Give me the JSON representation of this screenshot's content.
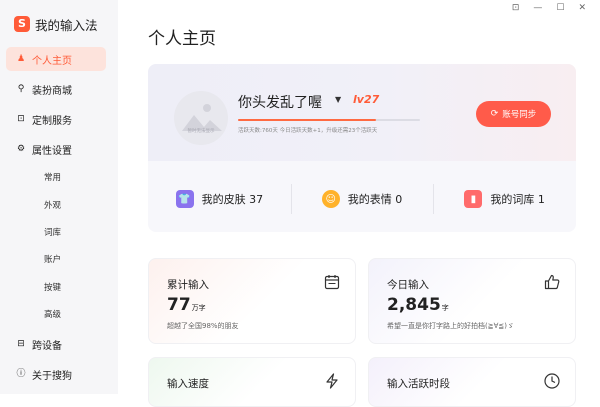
{
  "app": {
    "title": "我的输入法",
    "logo_letter": "S"
  },
  "window_controls": {
    "feedback": "⊡",
    "minimize": "—",
    "maximize": "☐",
    "close": "✕"
  },
  "sidebar": {
    "items": [
      {
        "label": "个人主页",
        "icon": "user-icon",
        "glyph": "♟"
      },
      {
        "label": "装扮商城",
        "icon": "shirt-icon",
        "glyph": "⚲"
      },
      {
        "label": "定制服务",
        "icon": "custom-icon",
        "glyph": "⊡"
      },
      {
        "label": "属性设置",
        "icon": "gear-icon",
        "glyph": "⚙"
      },
      {
        "label": "跨设备",
        "icon": "devices-icon",
        "glyph": "⊟"
      },
      {
        "label": "关于搜狗",
        "icon": "info-icon",
        "glyph": "ⓘ"
      }
    ],
    "settings_sub": [
      "常用",
      "外观",
      "词库",
      "账户",
      "按键",
      "高级"
    ]
  },
  "page_title": "个人主页",
  "profile": {
    "username": "你头发乱了喔",
    "level": "lv27",
    "avatar_caption": "暂时无法显示",
    "progress_percent": 76,
    "activity_text": "活跃天数:760天  今日活跃天数+1，升级还需23个活跃天",
    "sync_button": "账号同步"
  },
  "stats": [
    {
      "label": "我的皮肤 37",
      "icon": "skin-icon",
      "glyph": "👕"
    },
    {
      "label": "我的表情 0",
      "icon": "emoji-icon",
      "glyph": "☺"
    },
    {
      "label": "我的词库 1",
      "icon": "lexicon-icon",
      "glyph": "▮"
    }
  ],
  "cards": {
    "total": {
      "label": "累计输入",
      "value": "77",
      "unit": "万字",
      "note": "超越了全国98%的朋友"
    },
    "today": {
      "label": "今日输入",
      "value": "2,845",
      "unit": "字",
      "note": "希望一直是你打字路上的好拍档(≧∀≦)ゞ"
    },
    "speed": {
      "label": "输入速度"
    },
    "active": {
      "label": "输入活跃时段"
    }
  },
  "colors": {
    "accent": "#ff5b38",
    "sync_button": "#ff5b4a"
  }
}
